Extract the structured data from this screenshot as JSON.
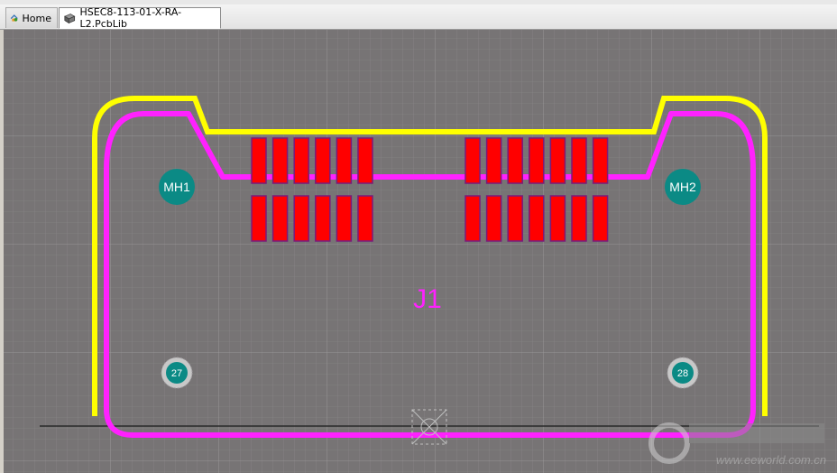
{
  "tabs": [
    {
      "label": "Home",
      "icon": "home-icon"
    },
    {
      "label": "HSEC8-113-01-X-RA-L2.PcbLib",
      "icon": "pcblib-icon"
    }
  ],
  "footprint": {
    "designator": "J1",
    "mounting_holes": [
      "MH1",
      "MH2"
    ],
    "pads": [
      "27",
      "28"
    ]
  },
  "watermark": "www.eeworld.com.cn",
  "colors": {
    "grid_background": "#777475",
    "grid_line": "#8c8a8b",
    "top_overlay": "#ffff00",
    "mechanical_outline": "#ff21ff",
    "smd_pad": "#ff0000",
    "smd_pad_border": "#7a1a7a",
    "multi_layer_pad": "#0b8a85",
    "pad_ring": "#c8c8c8",
    "board_edge_line": "#1a1a1a"
  }
}
